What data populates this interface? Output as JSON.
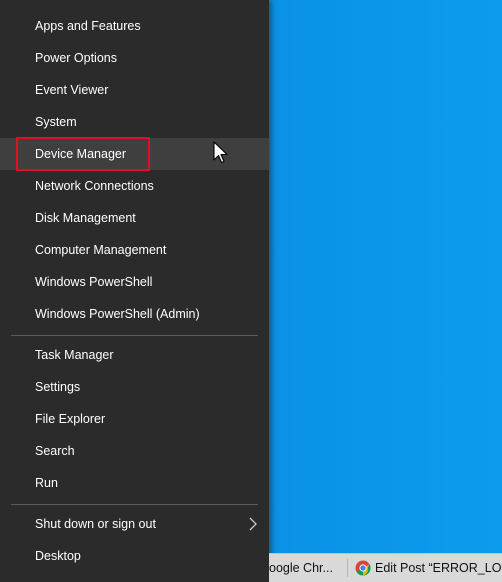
{
  "menu": {
    "group1": [
      {
        "label": "Apps and Features"
      },
      {
        "label": "Power Options"
      },
      {
        "label": "Event Viewer"
      },
      {
        "label": "System"
      },
      {
        "label": "Device Manager"
      },
      {
        "label": "Network Connections"
      },
      {
        "label": "Disk Management"
      },
      {
        "label": "Computer Management"
      },
      {
        "label": "Windows PowerShell"
      },
      {
        "label": "Windows PowerShell (Admin)"
      }
    ],
    "group2": [
      {
        "label": "Task Manager"
      },
      {
        "label": "Settings"
      },
      {
        "label": "File Explorer"
      },
      {
        "label": "Search"
      },
      {
        "label": "Run"
      }
    ],
    "group3": [
      {
        "label": "Shut down or sign out"
      },
      {
        "label": "Desktop"
      }
    ]
  },
  "taskbar": {
    "item1": "oogle Chr...",
    "item2": "Edit Post “ERROR_LO..."
  },
  "colors": {
    "menu_bg": "#2b2b2b",
    "hover_bg": "#3f3f3f",
    "highlight": "#e0101e",
    "desktop": "#0b8ae0"
  },
  "icons": [
    "chevron-right-icon",
    "mouse-cursor-icon",
    "chrome-icon"
  ]
}
